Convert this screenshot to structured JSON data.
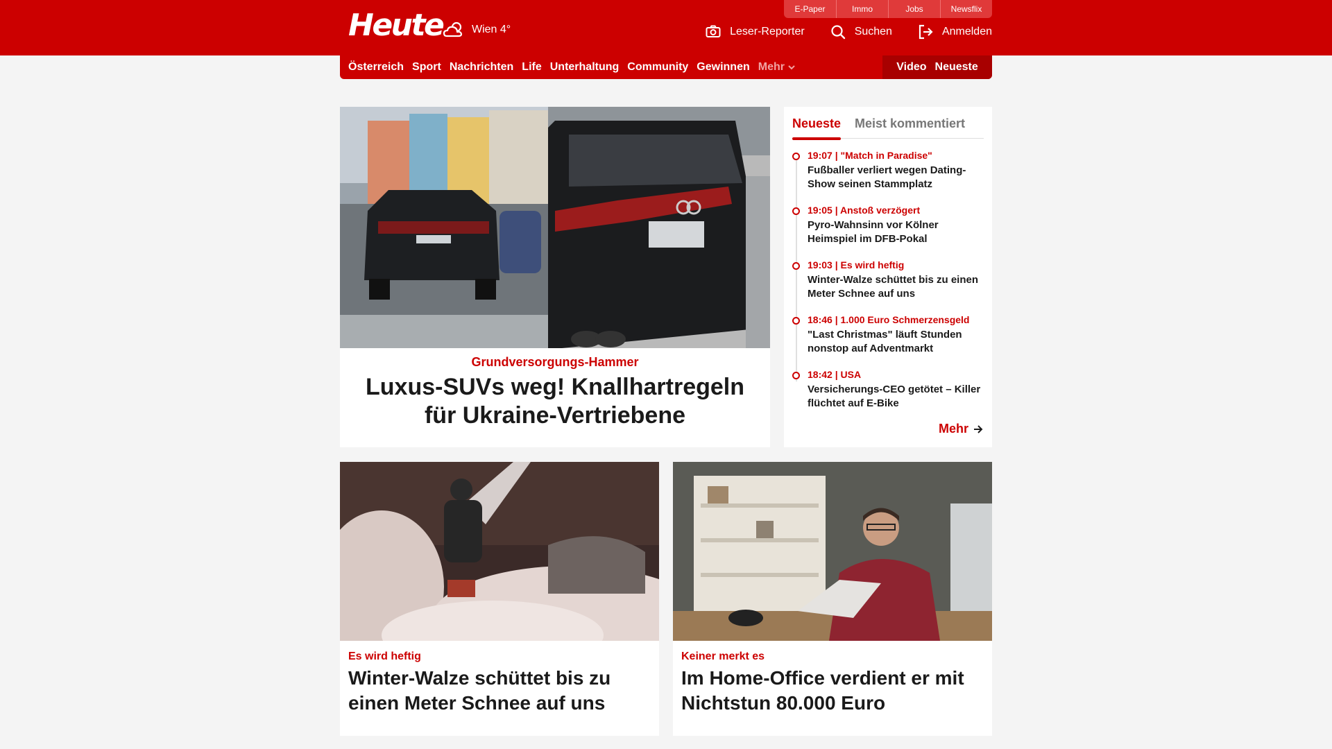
{
  "brand": {
    "logo_text": "Heute",
    "accent": "#cc0000"
  },
  "weather": {
    "label": "Wien 4°",
    "icon": "cloud-sun-icon"
  },
  "util_links": [
    "E-Paper",
    "Immo",
    "Jobs",
    "Newsflix"
  ],
  "actions": {
    "reporter": "Leser-Reporter",
    "search": "Suchen",
    "login": "Anmelden"
  },
  "nav": {
    "items": [
      "Österreich",
      "Sport",
      "Nachrichten",
      "Life",
      "Unterhaltung",
      "Community",
      "Gewinnen"
    ],
    "more": "Mehr",
    "video": "Video",
    "latest": "Neueste"
  },
  "hero": {
    "kicker": "Grundversorgungs-Hammer",
    "title": "Luxus-SUVs weg! Knallhartregeln für Ukraine-Vertriebene"
  },
  "sidebar": {
    "tabs": [
      "Neueste",
      "Meist kommentiert"
    ],
    "items": [
      {
        "meta": "19:07 | \"Match in Paradise\"",
        "headline": "Fußballer verliert wegen Dating-Show seinen Stammplatz"
      },
      {
        "meta": "19:05 | Anstoß verzögert",
        "headline": "Pyro-Wahnsinn vor Kölner Heimspiel im DFB-Pokal"
      },
      {
        "meta": "19:03 | Es wird heftig",
        "headline": "Winter-Walze schüttet bis zu einen Meter Schnee auf uns"
      },
      {
        "meta": "18:46 | 1.000 Euro Schmerzensgeld",
        "headline": "\"Last Christmas\" läuft Stunden nonstop auf Adventmarkt"
      },
      {
        "meta": "18:42 | USA",
        "headline": "Versicherungs-CEO getötet – Killer flüchtet auf E-Bike"
      }
    ],
    "more": "Mehr"
  },
  "cards": [
    {
      "kicker": "Es wird heftig",
      "title": "Winter-Walze schüttet bis zu einen Meter Schnee auf uns"
    },
    {
      "kicker": "Keiner merkt es",
      "title": "Im Home-Office verdient er mit Nichtstun 80.000 Euro"
    }
  ]
}
